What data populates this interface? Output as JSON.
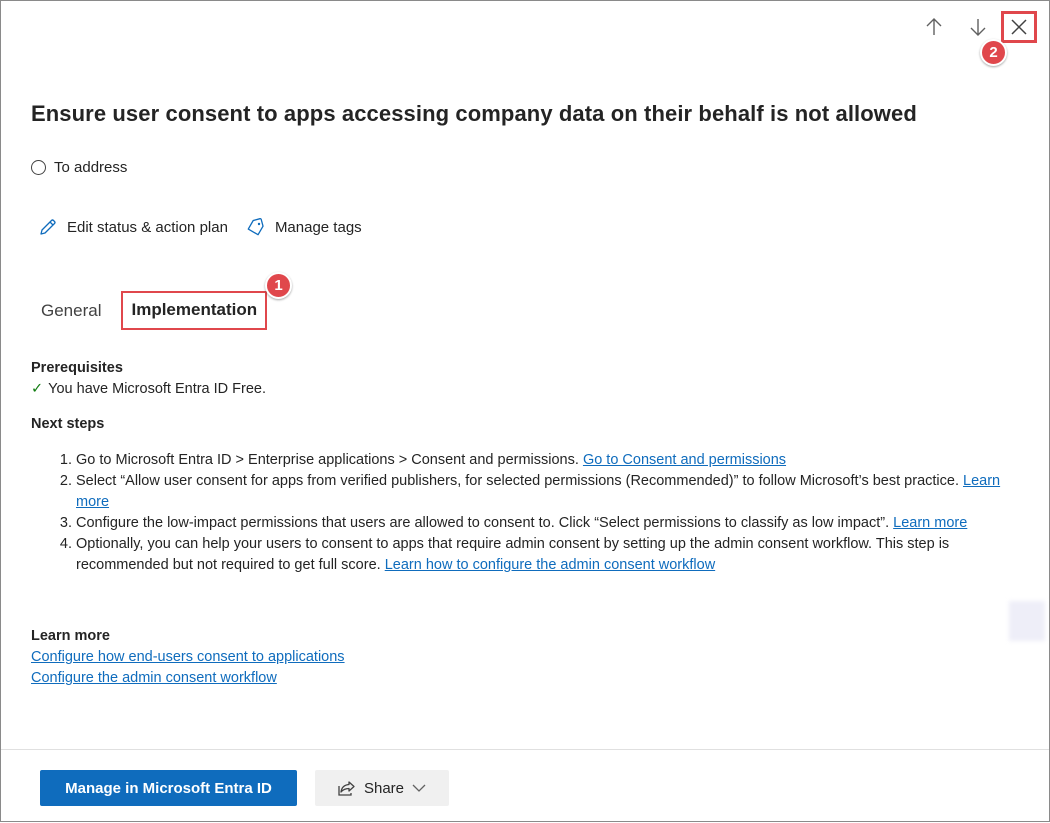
{
  "header": {
    "nav": {
      "up_icon": "arrow-up-icon",
      "down_icon": "arrow-down-icon",
      "close_icon": "close-icon"
    },
    "callouts": [
      "1",
      "2"
    ],
    "accent_color": "#e0474c"
  },
  "title": "Ensure user consent to apps accessing company data on their behalf is not allowed",
  "status": {
    "label": "To address"
  },
  "actions": {
    "edit": "Edit status & action plan",
    "tags": "Manage tags"
  },
  "tabs": [
    {
      "label": "General",
      "active": false
    },
    {
      "label": "Implementation",
      "active": true
    }
  ],
  "prerequisites": {
    "heading": "Prerequisites",
    "item": "You have Microsoft Entra ID Free."
  },
  "next_steps": {
    "heading": "Next steps",
    "steps": [
      {
        "text": "Go to Microsoft Entra ID > Enterprise applications > Consent and permissions. ",
        "link": "Go to Consent and permissions"
      },
      {
        "text": "Select “Allow user consent for apps from verified publishers, for selected permissions (Recommended)” to follow Microsoft’s best practice. ",
        "link": "Learn more"
      },
      {
        "text": "Configure the low-impact permissions that users are allowed to consent to. Click “Select permissions to classify as low impact”. ",
        "link": "Learn more"
      },
      {
        "text": "Optionally, you can help your users to consent to apps that require admin consent by setting up the admin consent workflow. This step is recommended but not required to get full score. ",
        "link": "Learn how to configure the admin consent workflow"
      }
    ]
  },
  "learn_more": {
    "heading": "Learn more",
    "links": [
      "Configure how end-users consent to applications",
      "Configure the admin consent workflow"
    ]
  },
  "footer": {
    "primary": "Manage in Microsoft Entra ID",
    "share": "Share",
    "primary_color": "#0f6cbd"
  }
}
